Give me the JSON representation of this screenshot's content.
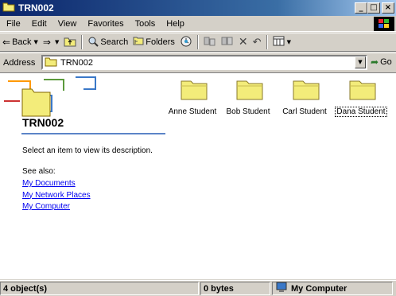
{
  "window": {
    "title": "TRN002",
    "controls": {
      "minimize": "_",
      "maximize": "□",
      "close": "×"
    }
  },
  "menu": [
    "File",
    "Edit",
    "View",
    "Favorites",
    "Tools",
    "Help"
  ],
  "toolbar": {
    "back_label": "Back",
    "search_label": "Search",
    "folders_label": "Folders"
  },
  "address": {
    "label": "Address",
    "value": "TRN002",
    "go_label": "Go"
  },
  "left_pane": {
    "folder_name": "TRN002",
    "description": "Select an item to view its description.",
    "see_also": "See also:",
    "links": [
      "My Documents",
      "My Network Places",
      "My Computer"
    ]
  },
  "items": [
    {
      "label": "Anne Student",
      "selected": false
    },
    {
      "label": "Bob Student",
      "selected": false
    },
    {
      "label": "Carl Student",
      "selected": false
    },
    {
      "label": "Dana Student",
      "selected": true
    }
  ],
  "status": {
    "objects": "4 object(s)",
    "size": "0 bytes",
    "zone": "My Computer"
  },
  "colors": {
    "titlebar_start": "#0a246a",
    "titlebar_end": "#a6caf0",
    "chrome": "#d4d0c8",
    "link": "#0000ee",
    "folder": "#f3ec7a"
  }
}
